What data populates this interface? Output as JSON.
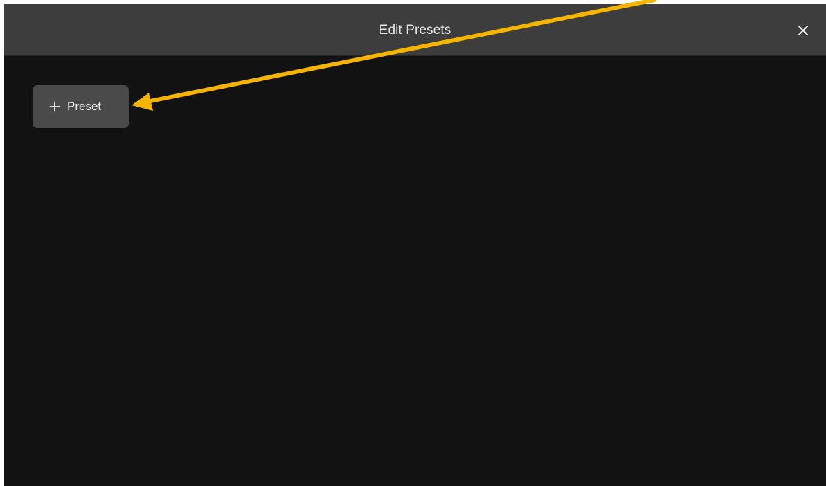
{
  "dialog": {
    "title": "Edit Presets",
    "close_icon": "close-icon",
    "add_preset": {
      "icon": "plus-icon",
      "label": "Preset"
    }
  },
  "annotation": {
    "type": "arrow",
    "color": "#f5b400"
  },
  "colors": {
    "header_background": "#3d3d3d",
    "body_background": "#121212",
    "button_background": "#4a4a4a"
  }
}
